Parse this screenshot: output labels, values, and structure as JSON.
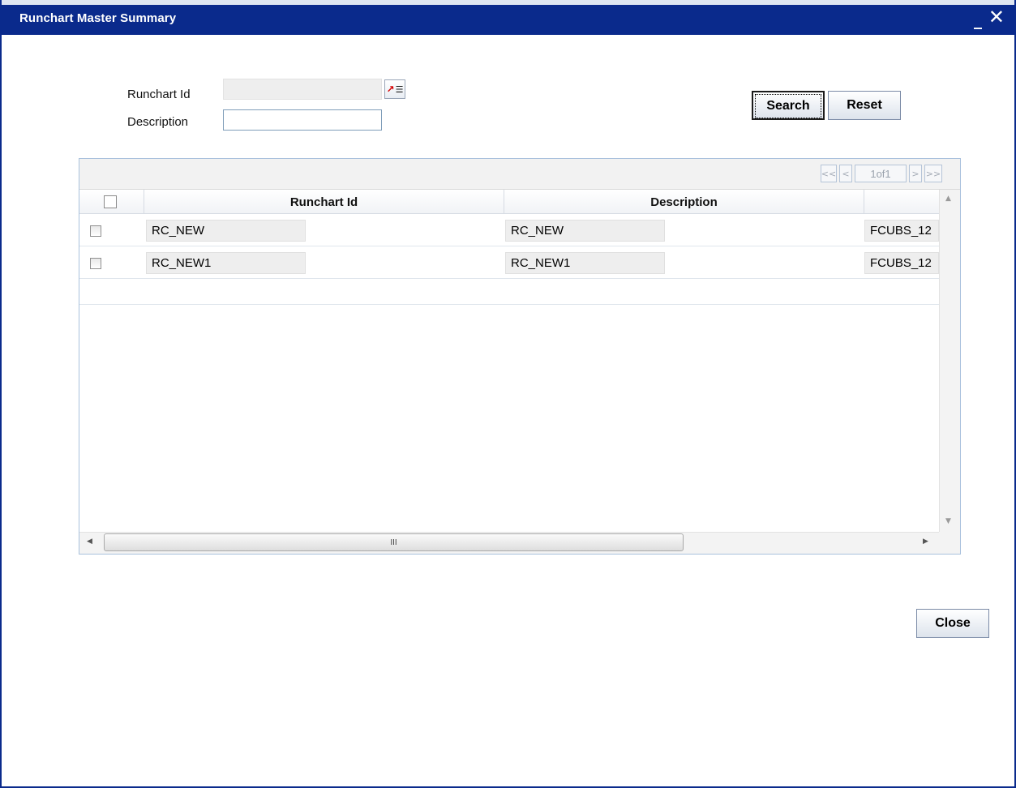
{
  "window": {
    "title": "Runchart Master Summary",
    "minimize_glyph": "_",
    "close_glyph": "✕"
  },
  "search_form": {
    "runchart_id_label": "Runchart Id",
    "runchart_id_value": "",
    "description_label": "Description",
    "description_value": "",
    "lov_icon": "list-of-values-icon",
    "search_label": "Search",
    "reset_label": "Reset"
  },
  "pagination": {
    "first": "<<",
    "prev": "<",
    "page_label": "1of1",
    "next": ">",
    "last": ">>"
  },
  "grid": {
    "columns": [
      "Runchart Id",
      "Description"
    ],
    "rows": [
      {
        "runchart_id": "RC_NEW",
        "description": "RC_NEW",
        "extra": "FCUBS_12"
      },
      {
        "runchart_id": "RC_NEW1",
        "description": "RC_NEW1",
        "extra": "FCUBS_12"
      }
    ],
    "hscroll_grip": "III"
  },
  "footer": {
    "close_label": "Close"
  },
  "colors": {
    "titlebar": "#0a2a8c",
    "grid_border": "#a9c1dd"
  }
}
